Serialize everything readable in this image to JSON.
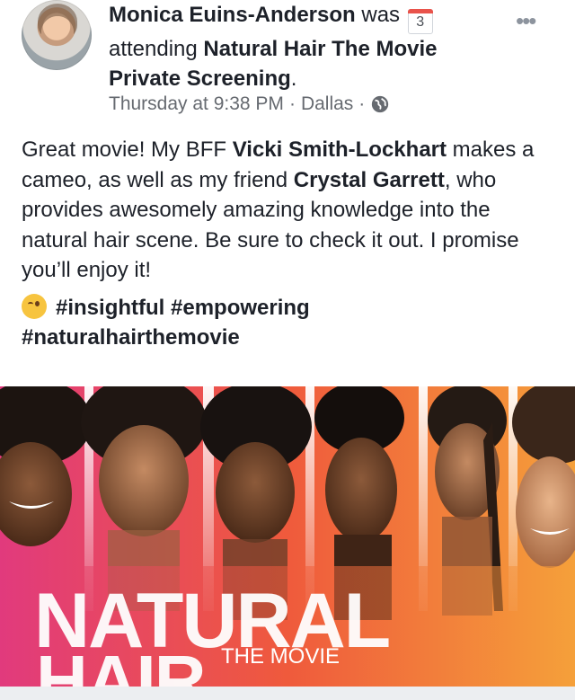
{
  "post": {
    "author_name": "Monica Euins-Anderson",
    "action_text": " was ",
    "calendar_day": "3",
    "action_suffix": "attending ",
    "event_name": "Natural Hair The Movie Private Screening",
    "event_period": ".",
    "timestamp": "Thursday at 9:38 PM",
    "separator1": "·",
    "location": "Dallas",
    "separator2": "·",
    "privacy_icon": "globe-icon",
    "more_icon": "•••",
    "body": {
      "part1": "Great movie! My BFF ",
      "mention1": "Vicki Smith-Lockhart",
      "part2": " makes a cameo, as well as my friend ",
      "mention2": "Crystal Garrett",
      "part3": ", who provides awesomely amazing knowledge into the natural hair scene. Be sure to check it out. I promise you’ll enjoy it!"
    },
    "emoji": "winking-face-emoji",
    "hashtags": [
      "#insightful",
      "#empowering",
      "#naturalhairthemovie"
    ]
  },
  "poster": {
    "title_line1": "NATURAL",
    "title_line2": "HAIR",
    "subtitle": "THE MOVIE"
  },
  "colors": {
    "poster_gradient": [
      "#e13a7d",
      "#ef5a3c",
      "#f5a03a"
    ],
    "text": "#1d2129",
    "meta": "#666a70"
  }
}
